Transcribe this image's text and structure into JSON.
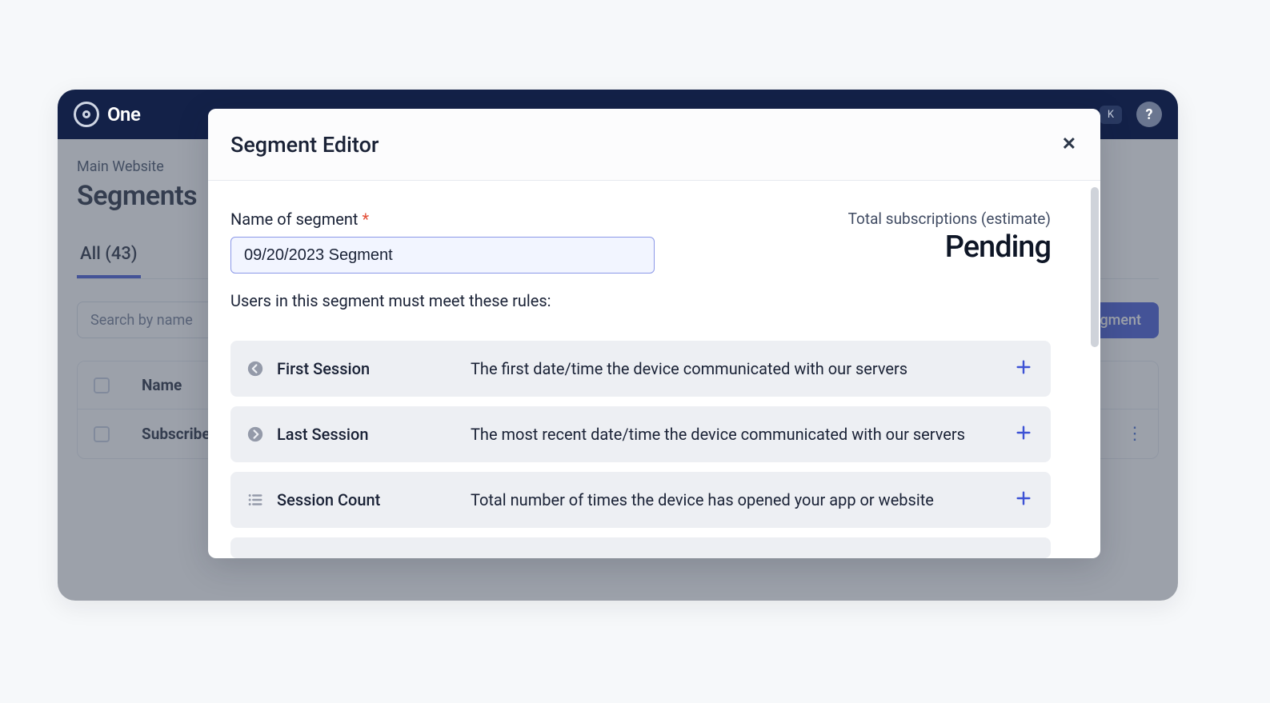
{
  "nav": {
    "brand": "OneSignal",
    "brand_partial": "One",
    "right_pill": "K",
    "help": "?"
  },
  "page": {
    "breadcrumb": "Main Website",
    "title": "Segments",
    "tab_all": "All (43)",
    "search_placeholder": "Search by name",
    "new_segment_btn": "New Segment",
    "new_segment_btn_partial": "gment",
    "col_name": "Name",
    "row1_name": "Subscribed Users"
  },
  "modal": {
    "title": "Segment Editor",
    "name_label": "Name of segment",
    "required_mark": "*",
    "name_value": "09/20/2023 Segment",
    "est_label": "Total subscriptions (estimate)",
    "est_value": "Pending",
    "rules_hint": "Users in this segment must meet these rules:",
    "rules": [
      {
        "icon": "arrow-left-circle",
        "name": "First Session",
        "desc": "The first date/time the device communicated with our servers"
      },
      {
        "icon": "arrow-right-circle",
        "name": "Last Session",
        "desc": "The most recent date/time the device communicated with our servers"
      },
      {
        "icon": "list",
        "name": "Session Count",
        "desc": "Total number of times the device has opened your app or website"
      }
    ]
  }
}
